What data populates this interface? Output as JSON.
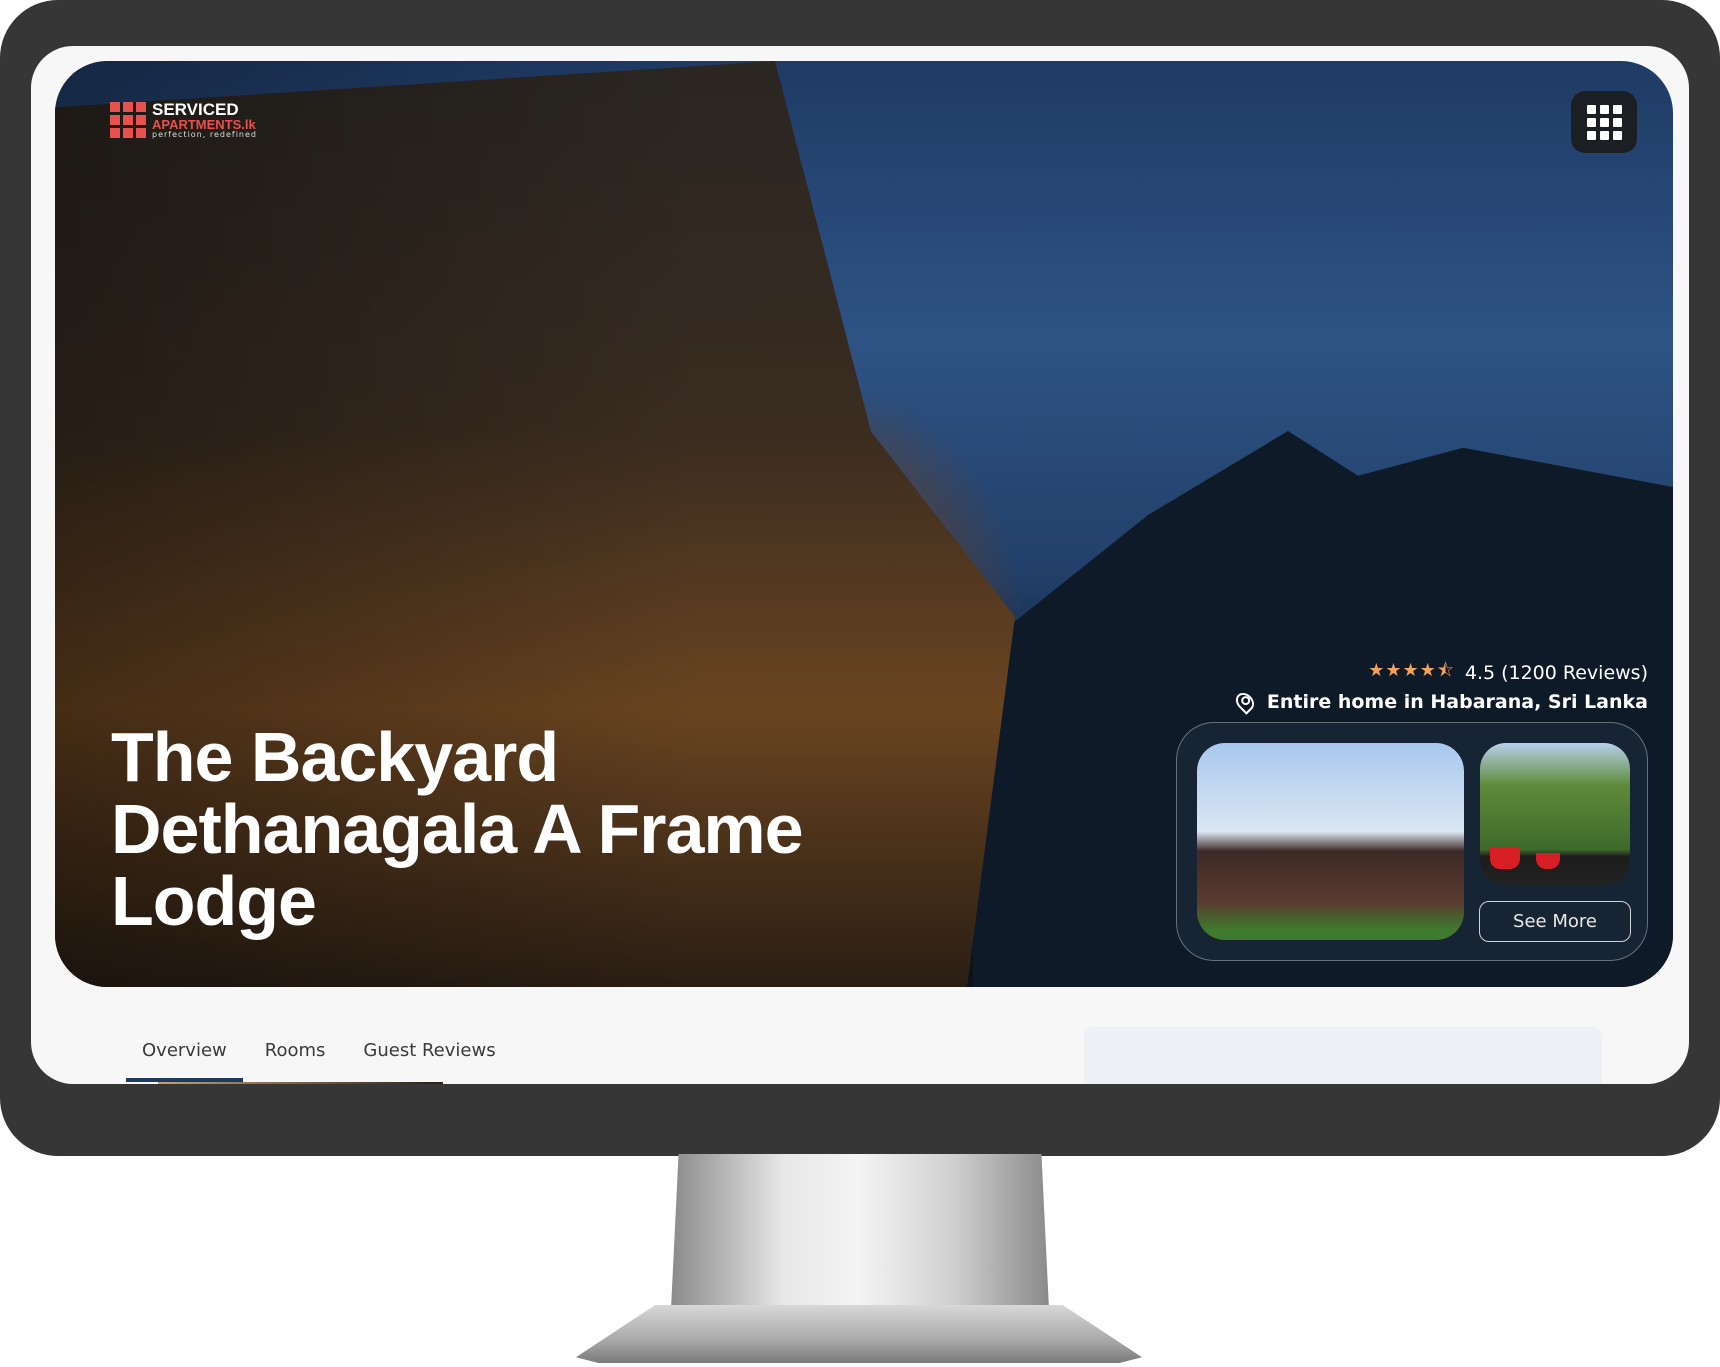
{
  "logo": {
    "line1": "SERVICED",
    "line2": "APARTMENTS.lk",
    "tagline": "perfection, redefined",
    "brand_color": "#e8514d"
  },
  "header": {
    "menu_icon": "grid-icon"
  },
  "hero": {
    "title": "The Backyard Dethanagala A Frame Lodge",
    "rating": {
      "stars": 4.5,
      "value": "4.5",
      "reviews": "(1200 Reviews)",
      "star_color": "#f2a25c"
    },
    "location": "Entire home in Habarana, Sri Lanka",
    "gallery": {
      "see_more_label": "See More"
    }
  },
  "tabs": [
    {
      "label": "Overview",
      "active": true
    },
    {
      "label": "Rooms"
    },
    {
      "label": "Guest Reviews"
    }
  ],
  "accent_color": "#1e3a5f"
}
